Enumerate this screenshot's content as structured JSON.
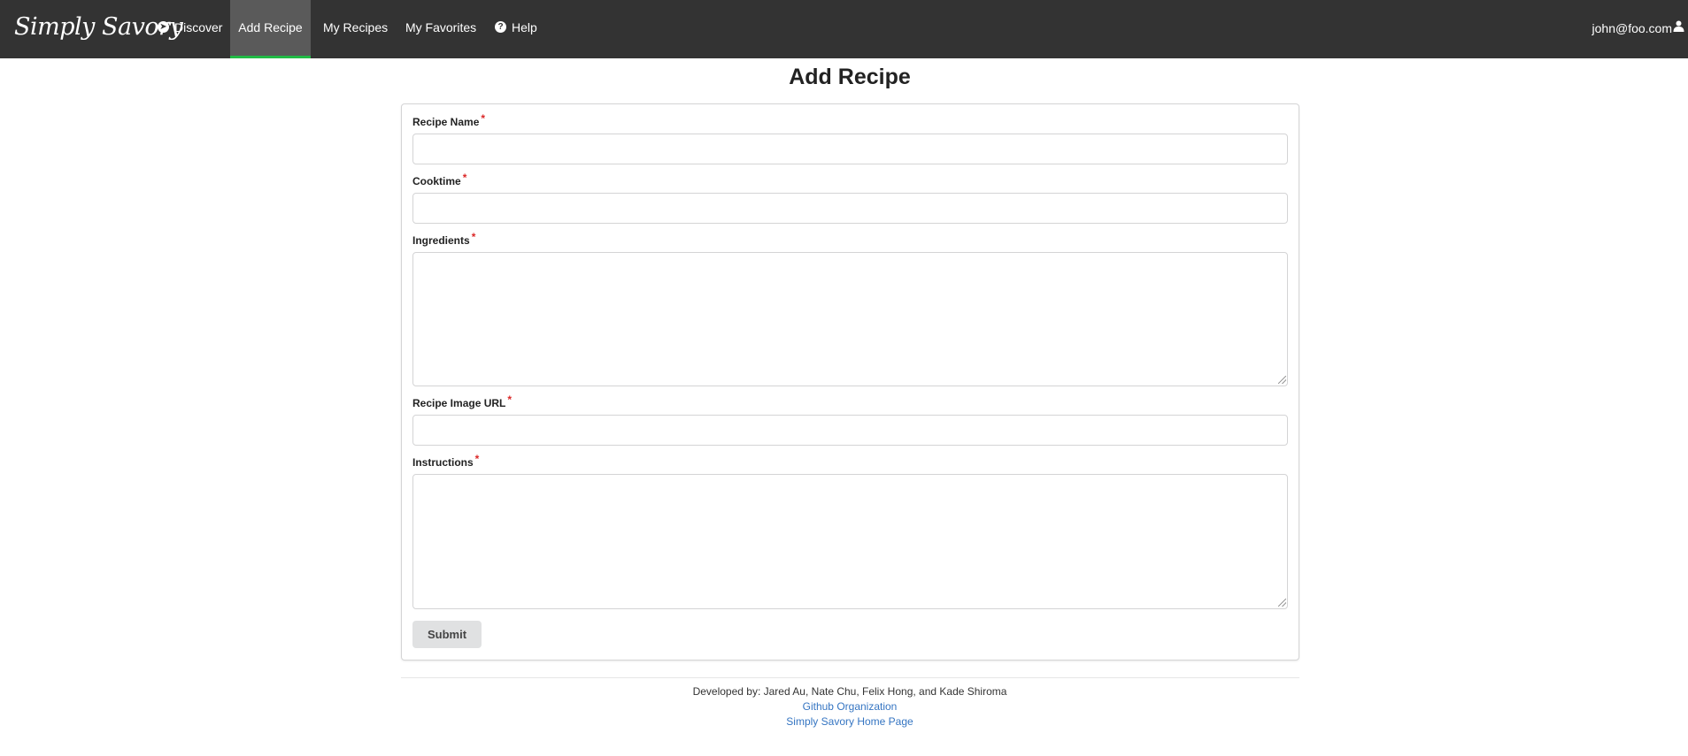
{
  "brand": {
    "name": "Simply Savory"
  },
  "nav": {
    "items": [
      {
        "label": "Discover",
        "icon": "compass-icon"
      },
      {
        "label": "Add Recipe",
        "active": true
      },
      {
        "label": "My Recipes"
      },
      {
        "label": "My Favorites"
      },
      {
        "label": "Help",
        "icon": "question-circle-icon"
      }
    ],
    "user": {
      "email": "john@foo.com",
      "icon": "user-icon"
    }
  },
  "page": {
    "title": "Add Recipe"
  },
  "form": {
    "required_marker": "*",
    "fields": [
      {
        "label": "Recipe Name",
        "value": ""
      },
      {
        "label": "Cooktime",
        "value": ""
      },
      {
        "label": "Ingredients",
        "value": ""
      },
      {
        "label": "Recipe Image URL",
        "value": ""
      },
      {
        "label": "Instructions",
        "value": ""
      }
    ],
    "submit_label": "Submit"
  },
  "footer": {
    "developed_by": "Developed by: Jared Au, Nate Chu, Felix Hong, and Kade Shiroma",
    "links": [
      {
        "label": "Github Organization"
      },
      {
        "label": "Simply Savory Home Page"
      }
    ]
  },
  "colors": {
    "navbar_bg": "#333333",
    "active_tab_bg": "#5a5a5a",
    "active_tab_underline": "#21ba45",
    "required_marker": "#db2828",
    "link": "#3575c2",
    "button_bg": "#e0e1e2"
  }
}
